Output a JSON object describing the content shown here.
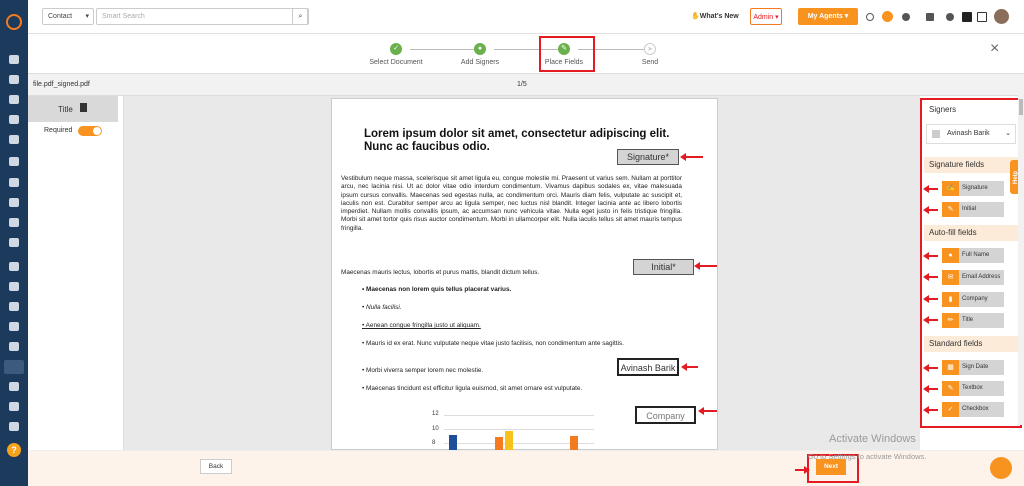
{
  "topbar": {
    "module": "Contact",
    "search_placeholder": "Smart Search",
    "whats_new": "What's New",
    "admin": "Admin",
    "agents": "My Agents"
  },
  "steps": [
    {
      "label": "Select Document",
      "state": "done"
    },
    {
      "label": "Add Signers",
      "state": "done"
    },
    {
      "label": "Place Fields",
      "state": "done"
    },
    {
      "label": "Send",
      "state": "pending"
    }
  ],
  "file": {
    "name": "file.pdf_signed.pdf",
    "page": "1/5"
  },
  "left_panel": {
    "title": "Title",
    "required_label": "Required"
  },
  "doc": {
    "heading": "Lorem ipsum dolor sit amet, consectetur adipiscing elit. Nunc ac faucibus odio.",
    "para1": "Vestibulum neque massa, scelerisque sit amet ligula eu, congue molestie mi. Praesent ut varius sem. Nullam at porttitor arcu, nec lacinia nisi. Ut ac dolor vitae odio interdum condimentum. Vivamus dapibus sodales ex, vitae malesuada ipsum cursus convallis. Maecenas sed egestas nulla, ac condimentum orci. Mauris diam felis, vulputate ac suscipit et, iaculis non est. Curabitur semper arcu ac ligula semper, nec luctus nisl blandit. Integer lacinia ante ac libero lobortis imperdiet. Nullam mollis convallis ipsum, ac accumsan nunc vehicula vitae. Nulla eget justo in felis tristique fringilla. Morbi sit amet tortor quis risus auctor condimentum. Morbi in ullamcorper elit. Nulla iaculis tellus sit amet mauris tempus fringilla.",
    "para2": "Maecenas mauris lectus, lobortis et purus mattis, blandit dictum tellus.",
    "bullets": [
      "Maecenas non lorem quis tellus placerat varius.",
      "Nulla facilisi.",
      "Aenean congue fringilla justo ut aliquam.",
      "Mauris id ex erat. Nunc vulputate neque vitae justo facilisis, non condimentum ante sagittis.",
      "Morbi viverra semper lorem nec molestie.",
      "Maecenas tincidunt est efficitur ligula euismod, sit amet ornare est vulputate."
    ],
    "fields": {
      "signature": "Signature*",
      "initial": "Initial*",
      "signer": "Avinash Barik",
      "company": "Company"
    },
    "chart_ticks": [
      "12",
      "10",
      "8"
    ]
  },
  "right_panel": {
    "signers_title": "Signers",
    "signer_name": "Avinash Barik",
    "signature_title": "Signature fields",
    "signature_items": [
      "Signature",
      "Initial"
    ],
    "autofill_title": "Auto-fill fields",
    "autofill_items": [
      "Full Name",
      "Email Address",
      "Company",
      "Title"
    ],
    "standard_title": "Standard fields",
    "standard_items": [
      "Sign Date",
      "Textbox",
      "Checkbox"
    ],
    "help": "Help"
  },
  "bottom": {
    "back": "Back",
    "next": "Next"
  },
  "watermark": {
    "title": "Activate Windows",
    "sub": "Go to Settings to activate Windows."
  }
}
